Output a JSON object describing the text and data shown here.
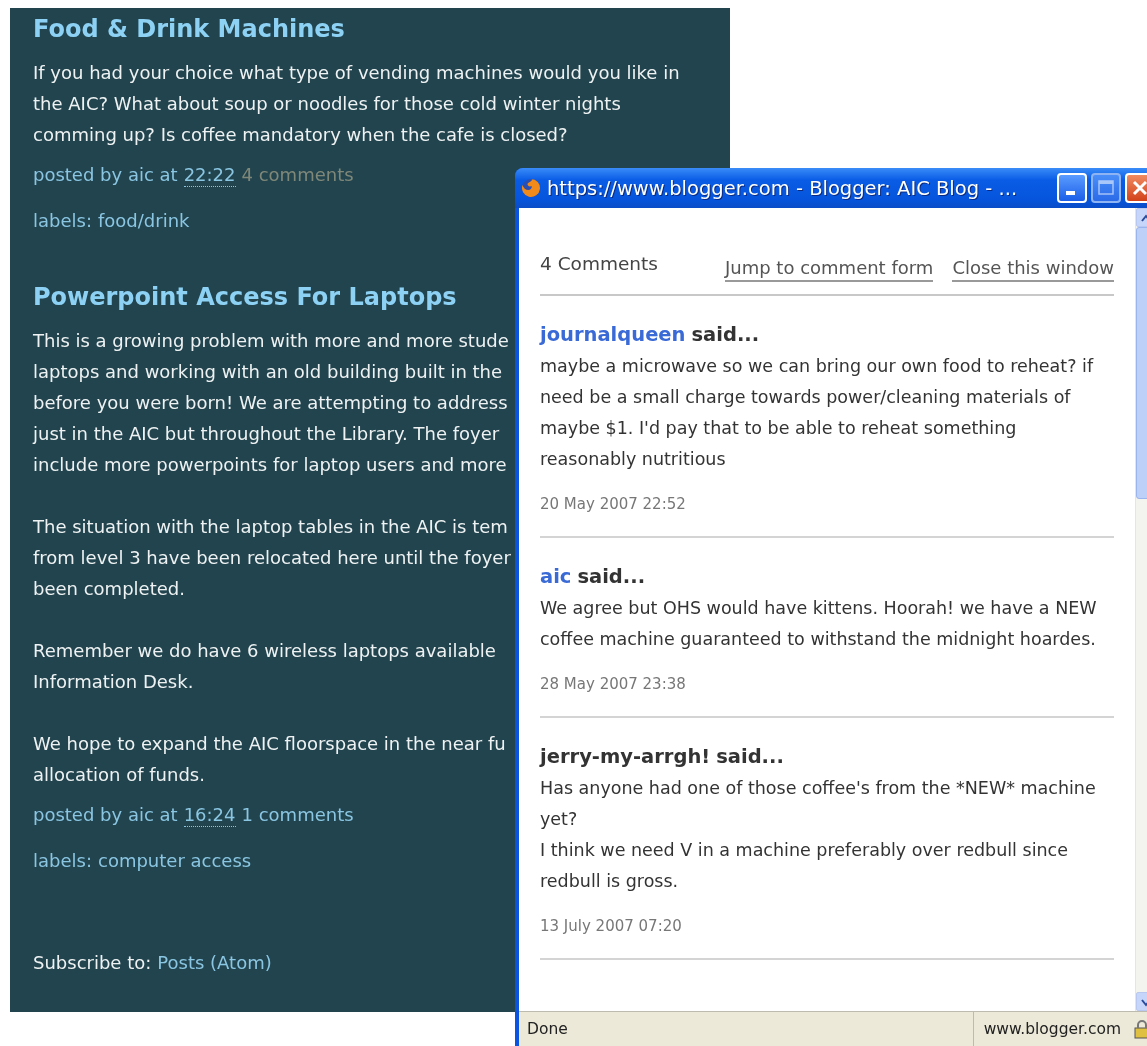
{
  "blog": {
    "posts": [
      {
        "title": "Food & Drink Machines",
        "paragraphs": [
          [
            "If you had your choice what type of vending machines would you like in",
            "the AIC? What about soup or noodles for those cold winter nights",
            "comming up? Is coffee mandatory when the cafe is closed?"
          ]
        ],
        "posted_by": "posted by aic at",
        "time": "22:22",
        "comments": "4 comments",
        "comments_visited": true,
        "labels_prefix": "labels:",
        "labels": [
          "food/drink"
        ]
      },
      {
        "title": "Powerpoint Access For Laptops",
        "paragraphs": [
          [
            "This is a growing problem with more and more stude",
            "laptops and working with an old building built in the",
            "before you were born! We are attempting to address",
            "just in the AIC but throughout the Library. The foyer",
            "include more powerpoints for laptop users and more"
          ],
          [
            "The situation with the laptop tables in the AIC is tem",
            "from level 3 have been relocated here until the foyer",
            "been completed."
          ],
          [
            "Remember we do have 6 wireless laptops available",
            "Information Desk."
          ],
          [
            "We hope to expand the AIC floorspace in the near fu",
            "allocation of funds."
          ]
        ],
        "posted_by": "posted by aic at",
        "time": "16:24",
        "comments": "1 comments",
        "comments_visited": false,
        "labels_prefix": "labels:",
        "labels": [
          "computer access"
        ]
      }
    ],
    "subscribe": {
      "label": "Subscribe to:",
      "link": "Posts (Atom)"
    }
  },
  "popup": {
    "title": "https://www.blogger.com - Blogger: AIC Blog - ...",
    "buttons": [
      {
        "kind": "minimize",
        "disabled": false
      },
      {
        "kind": "maximize",
        "disabled": true
      },
      {
        "kind": "close",
        "disabled": false
      }
    ],
    "heading": "4 Comments",
    "links": [
      "Jump to comment form",
      "Close this window"
    ],
    "comments": [
      {
        "author": "journalqueen",
        "author_linked": true,
        "said": "said...",
        "body": [
          "maybe a microwave so we can bring our own food to reheat? if",
          "need be a small charge towards power/cleaning materials of",
          "maybe $1. I'd pay that to be able to reheat something",
          "reasonably nutritious"
        ],
        "date": "20 May 2007 22:52"
      },
      {
        "author": "aic",
        "author_linked": true,
        "said": "said...",
        "body": [
          "We agree but OHS would have kittens. Hoorah! we have a NEW",
          "coffee machine guaranteed to withstand the midnight hoardes."
        ],
        "date": "28 May 2007 23:38"
      },
      {
        "author": "jerry-my-arrgh!",
        "author_linked": false,
        "said": "said...",
        "body": [
          "Has anyone had one of those coffee's from the *NEW* machine",
          "yet?",
          "I think we need V in a machine preferably over redbull since",
          "redbull is gross."
        ],
        "date": "13 July 2007 07:20"
      }
    ],
    "status": "Done",
    "status_host": "www.blogger.com"
  }
}
